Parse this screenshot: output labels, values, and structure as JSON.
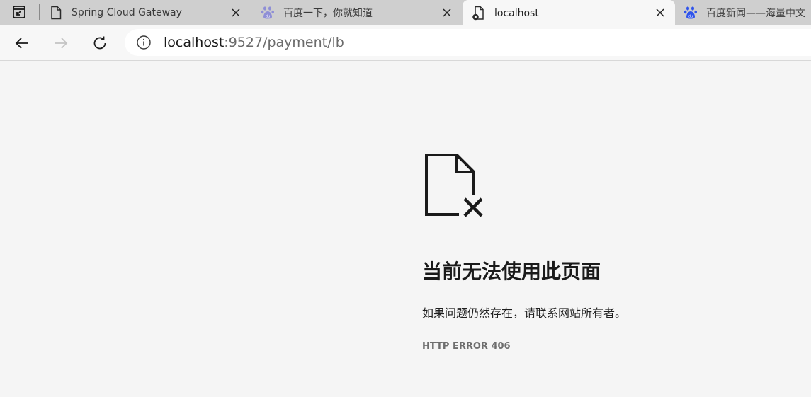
{
  "tabs": [
    {
      "title": "Spring Cloud Gateway",
      "favicon": "document-icon",
      "active": false
    },
    {
      "title": "百度一下，你就知道",
      "favicon": "baidu-paw-icon",
      "active": false
    },
    {
      "title": "localhost",
      "favicon": "document-error-icon",
      "active": true
    },
    {
      "title": "百度新闻——海量中文",
      "favicon": "baidu-paw-icon",
      "active": false
    }
  ],
  "toolbar": {
    "url_host": "localhost",
    "url_path": ":9527/payment/lb"
  },
  "error_page": {
    "heading": "当前无法使用此页面",
    "description": "如果问题仍然存在，请联系网站所有者。",
    "error_code": "HTTP ERROR 406"
  },
  "colors": {
    "tabstrip": "#cfcfcf",
    "toolbar": "#f7f7f7",
    "page_background": "#f5f5f5",
    "baidu_blue": "#2f54eb"
  }
}
